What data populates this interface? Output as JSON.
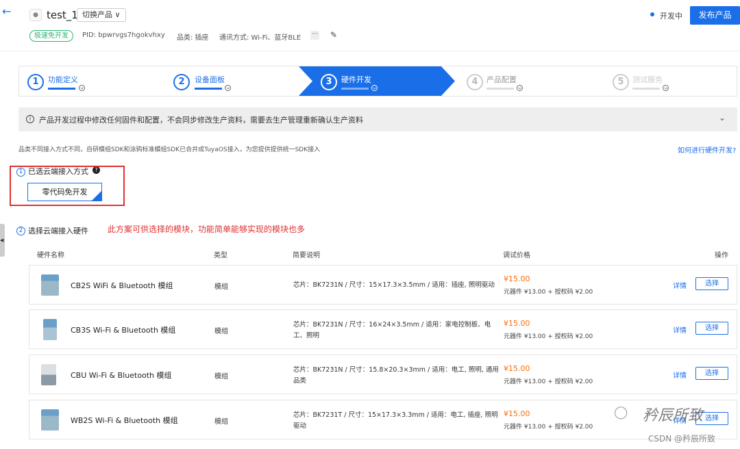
{
  "header": {
    "product_name": "test_1",
    "switch_label": "切换产品 ∨",
    "free_tag": "极速免开发",
    "pid": "PID: bpwrvgs7hgokvhxy",
    "category": "品类: 插座",
    "comm": "通讯方式: Wi-Fi、蓝牙BLE",
    "more": "···",
    "status": "开发中",
    "publish": "发布产品"
  },
  "steps": [
    {
      "num": "1",
      "label": "功能定义"
    },
    {
      "num": "2",
      "label": "设备面板"
    },
    {
      "num": "3",
      "label": "硬件开发"
    },
    {
      "num": "4",
      "label": "产品配置"
    },
    {
      "num": "5",
      "label": "测试服务"
    }
  ],
  "notice": "产品开发过程中修改任何固件和配置，不会同步修改生产资料，需要去生产管理重新确认生产资料",
  "description": "品类不同接入方式不同，自研模组SDK和涂鸦标准模组SDK已合并成TuyaOS接入，为您提供提供统一SDK接入",
  "help_link": "如何进行硬件开发?",
  "section1": {
    "num": "1",
    "title": "已选云端接入方式",
    "card": "零代码免开发"
  },
  "section2": {
    "num": "2",
    "title": "选择云端接入硬件"
  },
  "annotation": "此方案可供选择的模块，功能简单能够实现的模块也多",
  "table": {
    "headers": [
      "硬件名称",
      "类型",
      "简要说明",
      "调试价格",
      "操作"
    ],
    "rows": [
      {
        "name": "CB2S WiFi & Bluetooth 模组",
        "type": "模组",
        "desc": "芯片：BK7231N / 尺寸：15×17.3×3.5mm / 适用：插座, 照明驱动",
        "price": "¥15.00",
        "sub": "元器件 ¥13.00 + 授权码 ¥2.00",
        "detail": "详情",
        "select": "选择"
      },
      {
        "name": "CB3S Wi-Fi & Bluetooth 模组",
        "type": "模组",
        "desc": "芯片：BK7231N / 尺寸：16×24×3.5mm / 适用：家电控制板、电工、照明",
        "price": "¥15.00",
        "sub": "元器件 ¥13.00 + 授权码 ¥2.00",
        "detail": "详情",
        "select": "选择"
      },
      {
        "name": "CBU Wi-Fi & Bluetooth 模组",
        "type": "模组",
        "desc": "芯片：BK7231N / 尺寸：15.8×20.3×3mm / 适用：电工, 照明, 通用品类",
        "price": "¥15.00",
        "sub": "元器件 ¥13.00 + 授权码 ¥2.00",
        "detail": "详情",
        "select": "选择"
      },
      {
        "name": "WB2S Wi-Fi & Bluetooth 模组",
        "type": "模组",
        "desc": "芯片：BK7231T / 尺寸：15×17.3×3.3mm / 适用：电工, 插座, 照明驱动",
        "price": "¥15.00",
        "sub": "元器件 ¥13.00 + 授权码 ¥2.00",
        "detail": "详情",
        "select": "选择"
      }
    ]
  },
  "watermark": {
    "main": "矜辰所致",
    "sub": "CSDN @矜辰所致"
  }
}
